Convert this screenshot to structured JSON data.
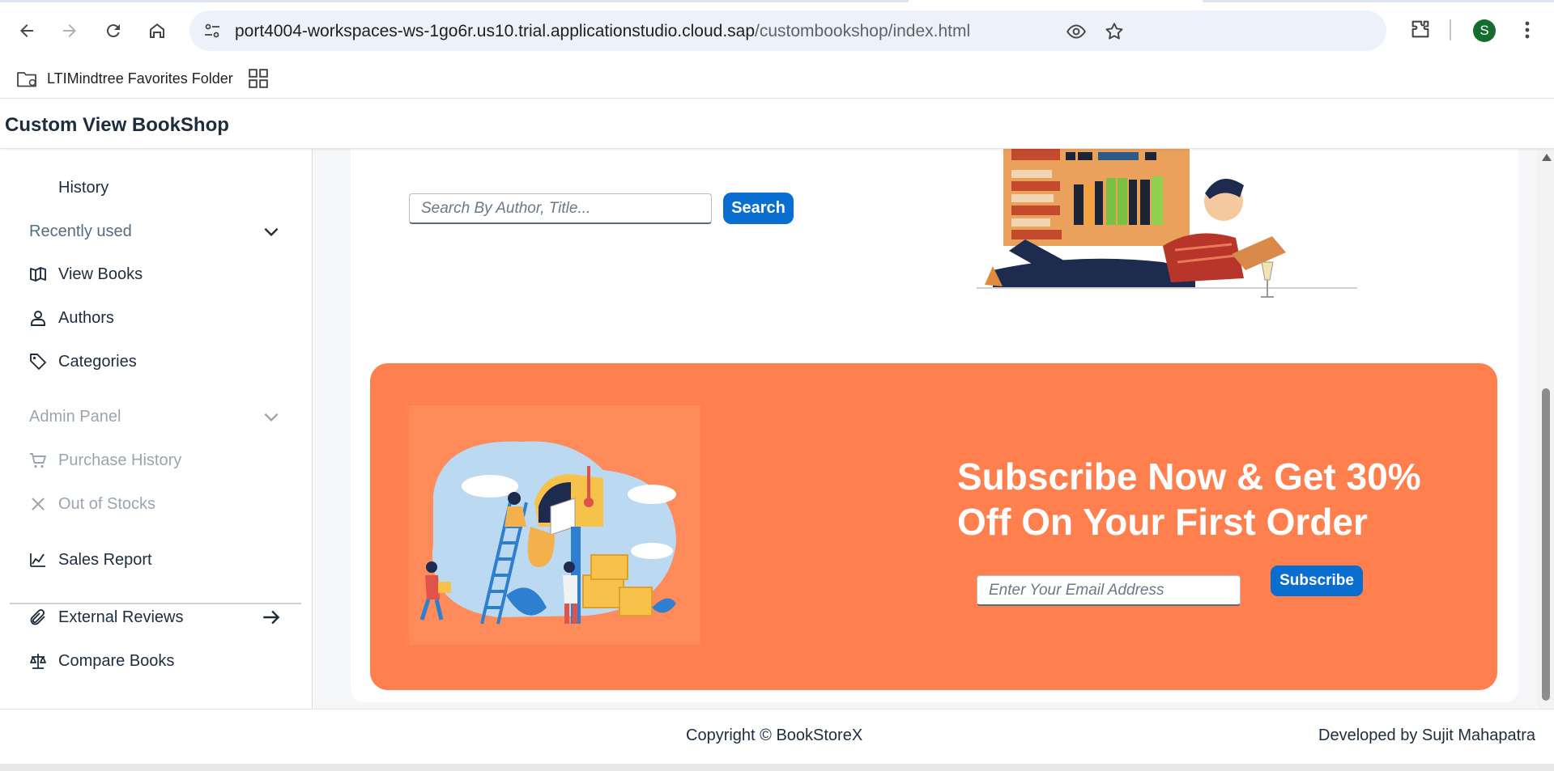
{
  "browser": {
    "url_host": "port4004-workspaces-ws-1go6r.us10.trial.applicationstudio.cloud.sap",
    "url_path": "/custombookshop/index.html",
    "profile_initial": "S",
    "bookmarks": [
      {
        "label": "LTIMindtree Favorites Folder",
        "icon": "folder-gear-icon"
      }
    ]
  },
  "app": {
    "title": "Custom View BookShop"
  },
  "sidebar": {
    "items": [
      {
        "label": "History",
        "icon": ""
      },
      {
        "label": "Recently used",
        "icon": "chevron-down-icon",
        "type": "group"
      },
      {
        "label": "View Books",
        "icon": "open-book-icon"
      },
      {
        "label": "Authors",
        "icon": "person-icon"
      },
      {
        "label": "Categories",
        "icon": "tags-icon"
      },
      {
        "label": "Admin Panel",
        "icon": "chevron-down-icon",
        "type": "group",
        "disabled": true
      },
      {
        "label": "Purchase History",
        "icon": "cart-icon",
        "disabled": true
      },
      {
        "label": "Out of Stocks",
        "icon": "close-icon",
        "disabled": true
      },
      {
        "label": "Sales Report",
        "icon": "line-chart-icon"
      },
      {
        "label": "External Reviews",
        "icon": "paperclip-icon",
        "trailing_icon": "arrow-right-icon"
      },
      {
        "label": "Compare Books",
        "icon": "scale-icon"
      }
    ]
  },
  "search": {
    "placeholder": "Search By Author, Title...",
    "button_label": "Search"
  },
  "promo": {
    "heading": "Subscribe Now & Get 30% Off On Your First Order",
    "email_placeholder": "Enter Your Email Address",
    "button_label": "Subscribe",
    "background_color": "#ff7f4f"
  },
  "footer": {
    "copyright": "Copyright © BookStoreX",
    "developer": "Developed by Sujit Mahapatra"
  },
  "colors": {
    "accent": "#0a6ed1",
    "promo": "#ff7f4f",
    "text": "#1d2d3e"
  }
}
